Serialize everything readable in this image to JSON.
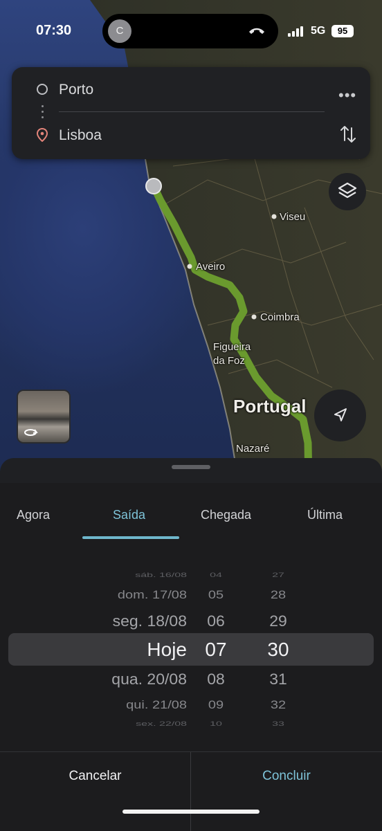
{
  "status": {
    "time": "07:30",
    "network": "5G",
    "battery": "95",
    "caller_initial": "C"
  },
  "route": {
    "origin": "Porto",
    "destination": "Lisboa"
  },
  "map": {
    "labels": {
      "viseu": "Viseu",
      "aveiro": "Aveiro",
      "coimbra": "Coimbra",
      "figueira": "Figueira\nda Foz",
      "portugal": "Portugal",
      "nazare": "Nazaré"
    },
    "route_color": "#6a9a2e"
  },
  "picker": {
    "tabs": [
      "Agora",
      "Saída",
      "Chegada",
      "Última"
    ],
    "active_tab": "Saída",
    "rows": [
      {
        "d": "sáb. 16/08",
        "h": "04",
        "m": "27"
      },
      {
        "d": "dom. 17/08",
        "h": "05",
        "m": "28"
      },
      {
        "d": "seg. 18/08",
        "h": "06",
        "m": "29"
      },
      {
        "d": "Hoje",
        "h": "07",
        "m": "30"
      },
      {
        "d": "qua. 20/08",
        "h": "08",
        "m": "31"
      },
      {
        "d": "qui. 21/08",
        "h": "09",
        "m": "32"
      },
      {
        "d": "sex. 22/08",
        "h": "10",
        "m": "33"
      }
    ],
    "cancel_label": "Cancelar",
    "done_label": "Concluir"
  },
  "colors": {
    "accent": "#7ec3d8",
    "background": "#1c1c1e"
  }
}
